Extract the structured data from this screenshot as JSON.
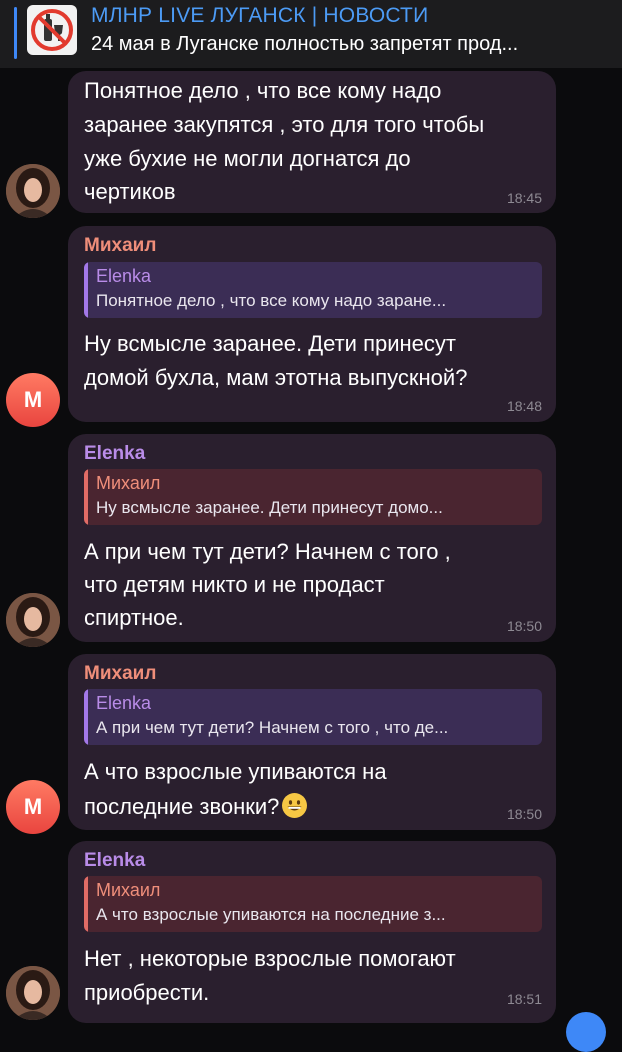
{
  "pinned": {
    "title": "МЛНР LIVE ЛУГАНСК | НОВОСТИ",
    "preview": "24 мая в Луганске полностью запретят прод..."
  },
  "messages": [
    {
      "lines": [
        "Понятное дело , что все кому надо",
        "заранее закупятся , это для того чтобы",
        "уже бухие не могли догнатся до",
        "чертиков"
      ],
      "time": "18:45"
    },
    {
      "sender": "Михаил",
      "reply_name": "Elenka",
      "reply_text": "Понятное дело , что все кому надо заране...",
      "lines": [
        "Ну всмысле заранее. Дети принесут",
        "домой бухла, мам этотна выпускной?"
      ],
      "time": "18:48",
      "avatar_letter": "М"
    },
    {
      "sender": "Elenka",
      "reply_name": "Михаил",
      "reply_text": "Ну всмысле заранее. Дети принесут домо...",
      "lines": [
        "А при чем тут дети? Начнем с того ,",
        "что детям никто и не продаст",
        "спиртное."
      ],
      "time": "18:50"
    },
    {
      "sender": "Михаил",
      "reply_name": "Elenka",
      "reply_text": "А при чем тут дети? Начнем с того , что де...",
      "lines": [
        "А что взрослые упиваются на",
        "последние звонки?"
      ],
      "emoji": "grinning-face-emoji",
      "time": "18:50",
      "avatar_letter": "М"
    },
    {
      "sender": "Elenka",
      "reply_name": "Михаил",
      "reply_text": "А что взрослые упиваются на последние з...",
      "lines": [
        "Нет , некоторые взрослые помогают",
        "приобрести."
      ],
      "time": "18:51"
    }
  ],
  "colors": {
    "accent": "#3e88f7",
    "bubble": "#2a1f2e",
    "name_mikhail": "#ef8e7a",
    "name_elenka": "#b98ce8"
  }
}
